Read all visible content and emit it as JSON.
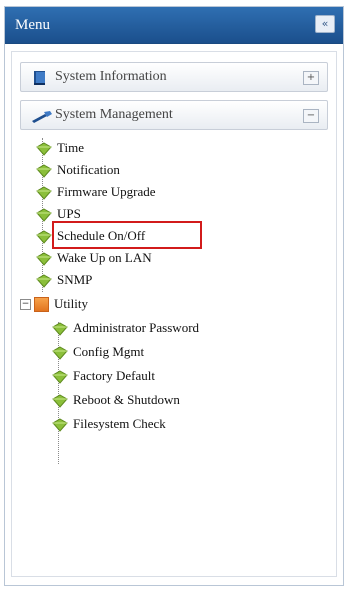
{
  "header": {
    "title": "Menu",
    "collapse_symbol": "«"
  },
  "sections": [
    {
      "label": "System Information",
      "toggle": "+",
      "icon": "book-icon"
    },
    {
      "label": "System Management",
      "toggle": "−",
      "icon": "wrench-icon"
    }
  ],
  "system_management_items": [
    {
      "label": "Time",
      "icon": "gem-icon"
    },
    {
      "label": "Notification",
      "icon": "gem-icon"
    },
    {
      "label": "Firmware Upgrade",
      "icon": "gem-icon"
    },
    {
      "label": "UPS",
      "icon": "gem-icon"
    },
    {
      "label": "Schedule On/Off",
      "icon": "gem-icon",
      "highlighted": true
    },
    {
      "label": "Wake Up on LAN",
      "icon": "gem-icon"
    },
    {
      "label": "SNMP",
      "icon": "gem-icon"
    }
  ],
  "utility": {
    "label": "Utility",
    "toggle": "−",
    "icon": "folder-icon",
    "items": [
      {
        "label": "Administrator Password",
        "icon": "gem-icon"
      },
      {
        "label": "Config Mgmt",
        "icon": "gem-icon"
      },
      {
        "label": "Factory Default",
        "icon": "gem-icon"
      },
      {
        "label": "Reboot & Shutdown",
        "icon": "gem-icon"
      },
      {
        "label": "Filesystem Check",
        "icon": "gem-icon"
      }
    ]
  },
  "colors": {
    "header_bg": "#2f6fb2",
    "highlight_border": "#d21b1b",
    "gem_green": "#8bbf3a",
    "folder_orange": "#f28c28"
  }
}
